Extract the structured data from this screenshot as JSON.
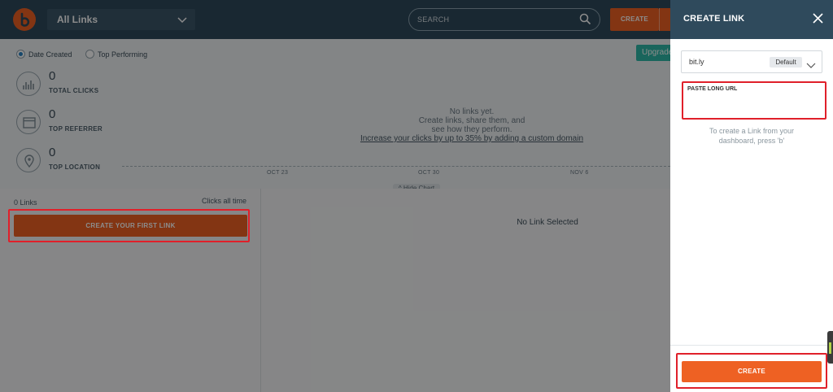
{
  "header": {
    "links_filter": "All Links",
    "search_placeholder": "SEARCH",
    "create_label": "CREATE"
  },
  "stats": {
    "sort_options": [
      {
        "label": "Date Created",
        "selected": true
      },
      {
        "label": "Top Performing",
        "selected": false
      }
    ],
    "upgrade_label": "Upgrade",
    "total_clicks": {
      "value": "0",
      "label": "TOTAL CLICKS"
    },
    "top_referrer": {
      "value": "0",
      "label": "TOP REFERRER"
    },
    "top_location": {
      "value": "0",
      "label": "TOP LOCATION"
    },
    "empty_line1": "No links yet.",
    "empty_line2": "Create links, share them, and",
    "empty_line3": "see how they perform.",
    "custom_domain_link": "Increase your clicks by up to 35% by adding a custom domain",
    "axis_ticks": [
      "OCT 23",
      "OCT 30",
      "NOV 6"
    ],
    "hide_chart_label": "Hide Chart"
  },
  "list": {
    "count_label": "0 Links",
    "clicks_label": "Clicks all time",
    "first_link_button": "CREATE YOUR FIRST LINK"
  },
  "detail": {
    "empty_label": "No Link Selected"
  },
  "panel": {
    "title": "CREATE LINK",
    "domain_value": "bit.ly",
    "domain_badge": "Default",
    "url_placeholder": "PASTE LONG URL",
    "hint": "To create a Link from your dashboard, press 'b'",
    "create_button": "CREATE"
  },
  "colors": {
    "header_bg": "#2f4a5c",
    "accent_orange": "#ee6123",
    "upgrade_teal": "#2eb8a8",
    "highlight_red": "#e0202a"
  }
}
